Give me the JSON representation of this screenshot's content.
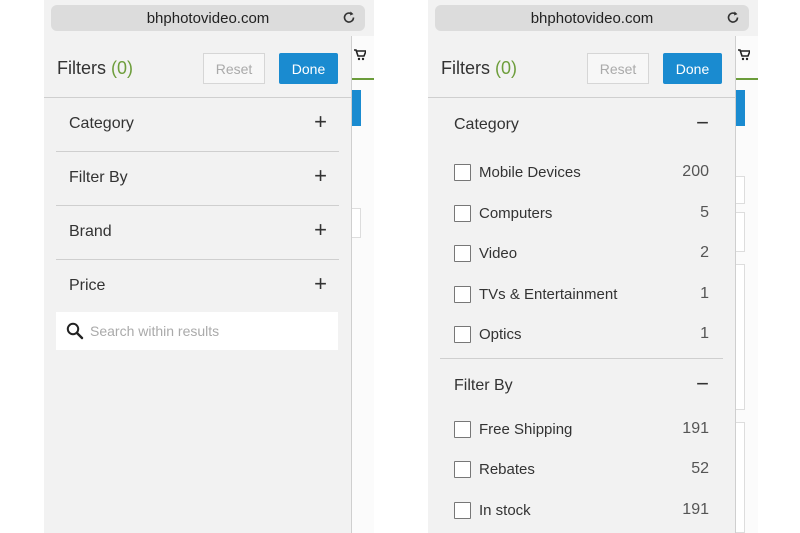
{
  "url": "bhphotovideo.com",
  "filters_label": "Filters",
  "filters_count": "(0)",
  "reset_label": "Reset",
  "done_label": "Done",
  "collapsed_sections": [
    {
      "label": "Category",
      "toggle": "+"
    },
    {
      "label": "Filter By",
      "toggle": "+"
    },
    {
      "label": "Brand",
      "toggle": "+"
    },
    {
      "label": "Price",
      "toggle": "+"
    }
  ],
  "search_placeholder": "Search within results",
  "expanded": {
    "category": {
      "label": "Category",
      "toggle": "−",
      "options": [
        {
          "label": "Mobile Devices",
          "count": "200"
        },
        {
          "label": "Computers",
          "count": "5"
        },
        {
          "label": "Video",
          "count": "2"
        },
        {
          "label": "TVs & Entertainment",
          "count": "1"
        },
        {
          "label": "Optics",
          "count": "1"
        }
      ]
    },
    "filter_by": {
      "label": "Filter By",
      "toggle": "−",
      "options": [
        {
          "label": "Free Shipping",
          "count": "191"
        },
        {
          "label": "Rebates",
          "count": "52"
        },
        {
          "label": "In stock",
          "count": "191"
        }
      ]
    }
  },
  "colors": {
    "accent_blue": "#1a8bd0",
    "count_green": "#6e9e3c"
  },
  "icons": {
    "reload": "reload-icon",
    "search": "search-icon",
    "cart": "cart-icon"
  }
}
